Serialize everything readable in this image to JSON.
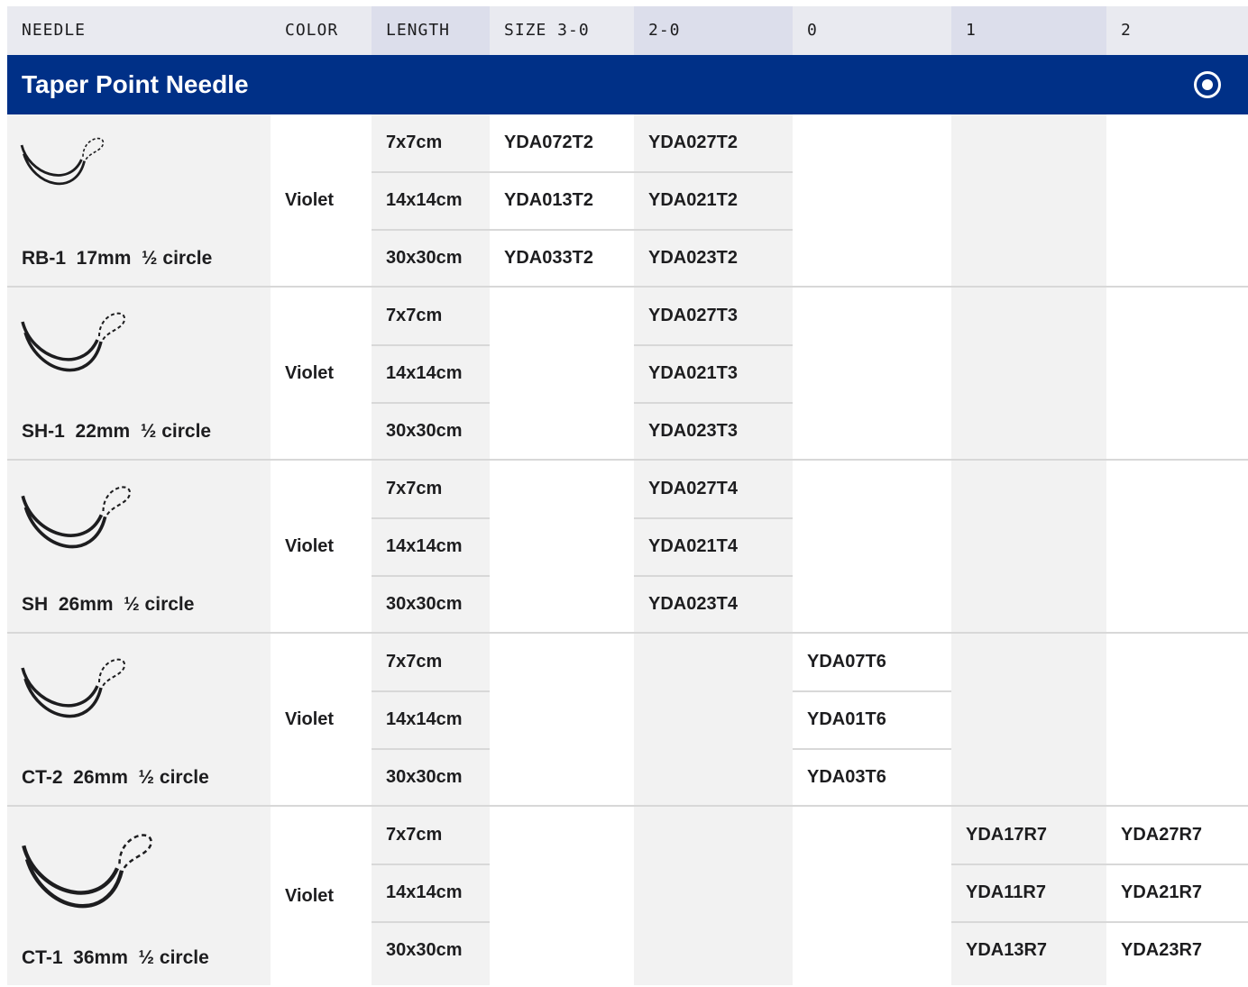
{
  "columns": [
    "NEEDLE",
    "COLOR",
    "LENGTH",
    "SIZE 3-0",
    "2-0",
    "0",
    "1",
    "2"
  ],
  "section": {
    "title": "Taper Point Needle",
    "toggle_icon": "radio-selected-icon"
  },
  "rows": [
    {
      "needle": "RB-1  17mm  ½ circle",
      "color": "Violet",
      "lengths": [
        "7x7cm",
        "14x14cm",
        "30x30cm"
      ],
      "size_3_0": [
        "YDA072T2",
        "YDA013T2",
        "YDA033T2"
      ],
      "size_2_0": [
        "YDA027T2",
        "YDA021T2",
        "YDA023T2"
      ],
      "size_0": [
        "",
        "",
        ""
      ],
      "size_1": [
        "",
        "",
        ""
      ],
      "size_2": [
        "",
        "",
        ""
      ]
    },
    {
      "needle": "SH-1  22mm  ½ circle",
      "color": "Violet",
      "lengths": [
        "7x7cm",
        "14x14cm",
        "30x30cm"
      ],
      "size_3_0": [
        "",
        "",
        ""
      ],
      "size_2_0": [
        "YDA027T3",
        "YDA021T3",
        "YDA023T3"
      ],
      "size_0": [
        "",
        "",
        ""
      ],
      "size_1": [
        "",
        "",
        ""
      ],
      "size_2": [
        "",
        "",
        ""
      ]
    },
    {
      "needle": "SH  26mm  ½ circle",
      "color": "Violet",
      "lengths": [
        "7x7cm",
        "14x14cm",
        "30x30cm"
      ],
      "size_3_0": [
        "",
        "",
        ""
      ],
      "size_2_0": [
        "YDA027T4",
        "YDA021T4",
        "YDA023T4"
      ],
      "size_0": [
        "",
        "",
        ""
      ],
      "size_1": [
        "",
        "",
        ""
      ],
      "size_2": [
        "",
        "",
        ""
      ]
    },
    {
      "needle": "CT-2  26mm  ½ circle",
      "color": "Violet",
      "lengths": [
        "7x7cm",
        "14x14cm",
        "30x30cm"
      ],
      "size_3_0": [
        "",
        "",
        ""
      ],
      "size_2_0": [
        "",
        "",
        ""
      ],
      "size_0": [
        "YDA07T6",
        "YDA01T6",
        "YDA03T6"
      ],
      "size_1": [
        "",
        "",
        ""
      ],
      "size_2": [
        "",
        "",
        ""
      ]
    },
    {
      "needle": "CT-1  36mm  ½ circle",
      "color": "Violet",
      "lengths": [
        "7x7cm",
        "14x14cm",
        "30x30cm"
      ],
      "size_3_0": [
        "",
        "",
        ""
      ],
      "size_2_0": [
        "",
        "",
        ""
      ],
      "size_0": [
        "",
        "",
        ""
      ],
      "size_1": [
        "YDA17R7",
        "YDA11R7",
        "YDA13R7"
      ],
      "size_2": [
        "YDA27R7",
        "YDA21R7",
        "YDA23R7"
      ]
    }
  ]
}
